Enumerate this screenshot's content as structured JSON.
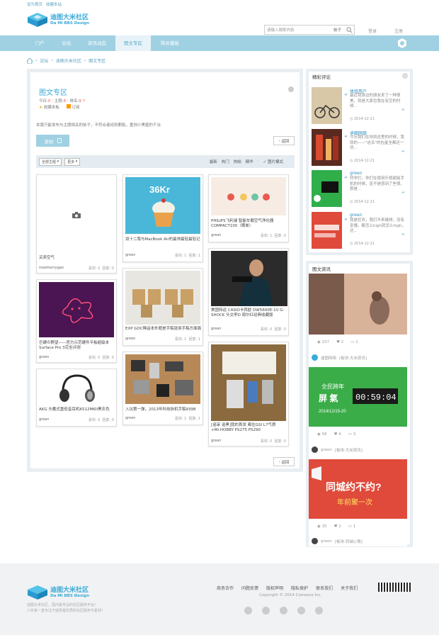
{
  "topbar": {
    "home": "设为首页",
    "fav": "收藏本站"
  },
  "logo": {
    "name": "迪图大米社区",
    "sub": "Da Mi BBS Design"
  },
  "search": {
    "placeholder": "请输入搜索内容",
    "category": "帖子"
  },
  "account": {
    "login": "登录",
    "register": "注册"
  },
  "nav": [
    "门户",
    "论坛",
    "资讯动态",
    "图文专区",
    "购买模板"
  ],
  "breadcrumb": [
    "论坛",
    "迪图大米社区",
    "图文专区"
  ],
  "forum": {
    "title": "图文专区",
    "stats_today_label": "今日:",
    "stats_today": "0",
    "stats_topics_label": "主题:",
    "stats_topics": "8",
    "stats_rank_label": "排名:",
    "stats_rank": "9",
    "fav_label": "收藏本板",
    "rss_label": "订阅",
    "description": "本版只能发布与主题相关的帖子，不符合者经则删贴，重则小黑屋的干淡",
    "post_label": "发帖",
    "back_label": "返回"
  },
  "filter": {
    "all_label": "全部主题",
    "more_label": "更多",
    "sorts": [
      "最新",
      "热门",
      "热帖",
      "精华"
    ],
    "pic_mode": "图片模式"
  },
  "cards": [
    {
      "title": "买卖空气",
      "user": "rosemerrygao",
      "views": "喜欢: 0",
      "replies": "回复: 0"
    },
    {
      "title": "巨硬の野望——官方示范硬件平板超级本 Surface Pro 3完全评测",
      "user": "green",
      "views": "喜欢: 0",
      "replies": "回复: 0"
    },
    {
      "title": "AKG 头戴式重低音耳机K512MKII黑灰色",
      "user": "green",
      "views": "喜欢: 0",
      "replies": "回复: 0"
    },
    {
      "title": "双十二我与MacBook Air的最帅最轻最轻记",
      "user": "green",
      "views": "喜欢: 1",
      "replies": "回复: 1"
    },
    {
      "title": "EXP GDC稀话本外题是手稿就用手稿方面面",
      "user": "green",
      "views": "喜欢: 1",
      "replies": "回复: 1"
    },
    {
      "title": "入坑第一弹，2013年科技拆机手稿9398",
      "user": "green",
      "views": "喜欢: 1",
      "replies": "回复: 1"
    },
    {
      "title": "PHILIPS飞利浦 智能车载空气净化器 COMPACT100（晒单）",
      "user": "green",
      "views": "喜欢: 1",
      "replies": "回复: 0"
    },
    {
      "title": "美国特运 CASIO卡西欧 DW5600E-1V G-SHOCK 头交李D 周尔红经典收藏版",
      "user": "green",
      "views": "喜欢: 0",
      "replies": "回复: 0"
    },
    {
      "title": "[追审 追黑]我的首发 都住GSI L7气质+Mr.HOBBY PS275 PS290",
      "user": "green",
      "views": "喜欢: 0",
      "replies": "回复: 0"
    }
  ],
  "comments_widget": {
    "title": "精彩评论",
    "items": [
      {
        "name": "体验用户",
        "text": "最近我身边的朋友发了一种很美，就是大家拉我在有空的时候...",
        "date": "2014-12-21"
      },
      {
        "name": "迪图网络",
        "text": "今天我们在地到这里的时候，我就的——\"这名\"的包星全都还一坊...",
        "date": "2014-12-21"
      },
      {
        "name": "green",
        "text": "同学们，你们在使用乐视超级手机的时候，显不是感到了些很，那是...",
        "date": "2014-12-21"
      },
      {
        "name": "green",
        "text": "我是狂欢，我们不来编排，没有幸懂，都怎么high就怎么high，还...",
        "date": "2014-12-21"
      }
    ]
  },
  "news_widget": {
    "title": "图文资讯",
    "posts": [
      {
        "views": "157",
        "likes": "2",
        "comments": "1",
        "author": "迪图网络",
        "forum": "[板块·大米资讯]"
      },
      {
        "views": "58",
        "likes": "4",
        "comments": "3",
        "author": "green",
        "forum": "[板块·大米资讯]"
      },
      {
        "views": "35",
        "likes": "1",
        "comments": "1",
        "author": "green",
        "forum": "[板块·同城心情]"
      }
    ],
    "poster2": {
      "line1": "全民跨年",
      "line2": "屏 氣",
      "date": "2014/12/15-20",
      "timer": "00:59:04"
    },
    "poster3": {
      "line1": "同城约不约?",
      "line2": "年前聚一次"
    }
  },
  "footer": {
    "links": [
      "商务合作",
      "问题反馈",
      "版权声明",
      "隐私保护",
      "联系我们",
      "关于我们"
    ],
    "copyright": "Copyright © 2014 Comsenz Inc.",
    "desc1": "迪图大米社区，国内最专业的社区服务平台！",
    "desc2": "六年来一直专注于提供最优质的社区服务与素材！"
  }
}
